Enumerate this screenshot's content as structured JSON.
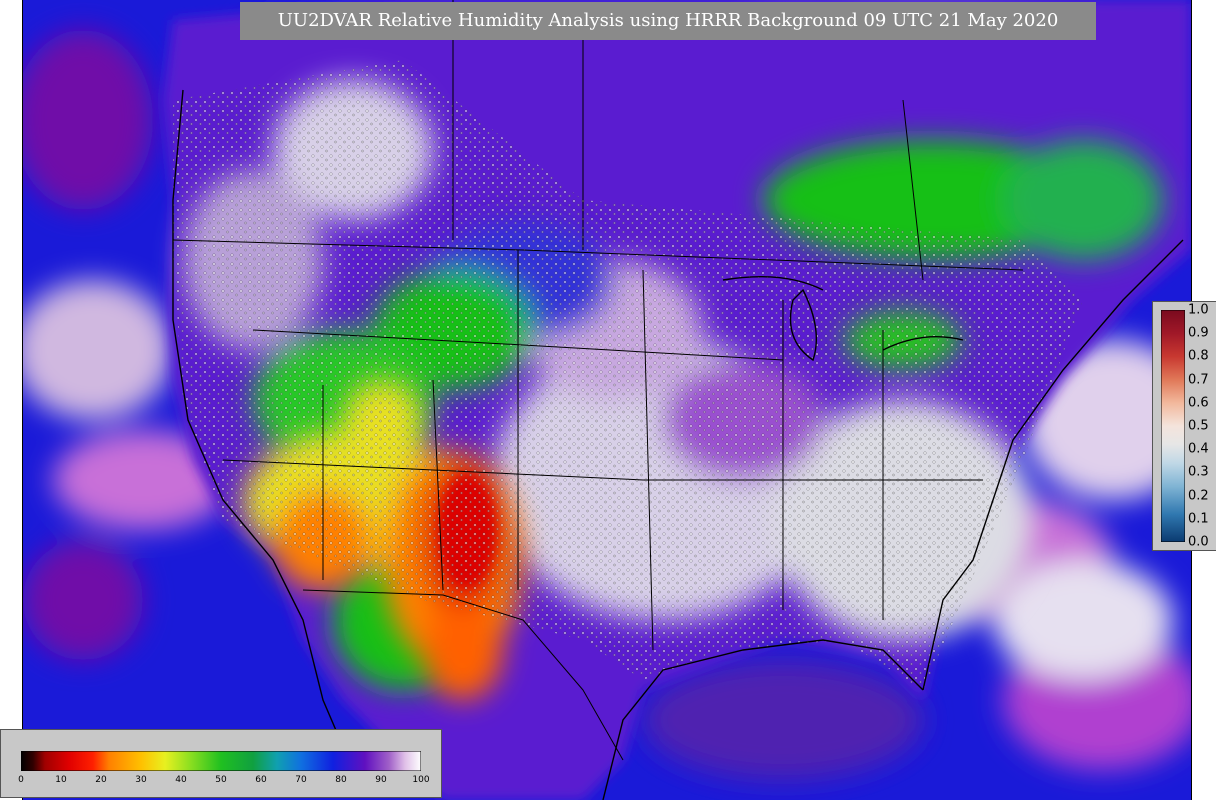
{
  "title": "UU2DVAR Relative Humidity Analysis using HRRR Background 09 UTC 21 May 2020",
  "colors": {
    "ocean_blue": "#1a1ad8",
    "deep_purple": "#6a0a9a",
    "magenta": "#b040d0",
    "white_moist": "#e8e8f0",
    "gray_land": "#c8c8c8",
    "green": "#18c018",
    "yellow": "#e8e020",
    "orange": "#ff8000",
    "red": "#e00000"
  },
  "rh_colorbar": {
    "ticks": [
      "0",
      "10",
      "20",
      "30",
      "40",
      "50",
      "60",
      "70",
      "80",
      "90",
      "100"
    ]
  },
  "increment_colorbar": {
    "ticks": [
      "1.0",
      "0.9",
      "0.8",
      "0.7",
      "0.6",
      "0.5",
      "0.4",
      "0.3",
      "0.2",
      "0.1",
      "0.0"
    ]
  }
}
